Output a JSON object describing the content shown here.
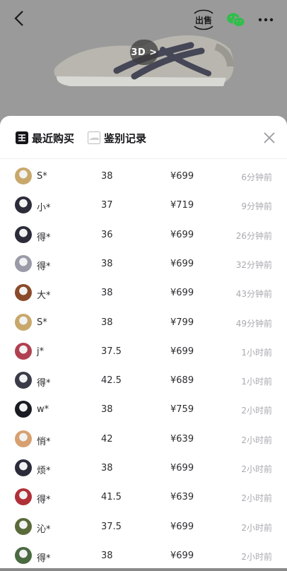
{
  "header": {
    "back_icon": "chevron-left-icon",
    "sell_label": "出售",
    "wechat_icon": "wechat-icon",
    "more_icon": "more-icon",
    "badge_3d": "3D >"
  },
  "sheet": {
    "tabs": [
      {
        "label": "最近购买",
        "icon": "dewu-logo-icon",
        "active": true
      },
      {
        "label": "鉴别记录",
        "icon": "shoe-thumbnail-icon",
        "active": false
      }
    ],
    "close_icon": "close-icon"
  },
  "records": [
    {
      "name": "S*",
      "size": "38",
      "price": "¥699",
      "time": "6分钟前",
      "avatar_color": "#c8a86a"
    },
    {
      "name": "小*",
      "size": "37",
      "price": "¥719",
      "time": "9分钟前",
      "avatar_color": "#2b2b3a"
    },
    {
      "name": "得*",
      "size": "36",
      "price": "¥699",
      "time": "26分钟前",
      "avatar_color": "#2b2b3a"
    },
    {
      "name": "得*",
      "size": "38",
      "price": "¥699",
      "time": "32分钟前",
      "avatar_color": "#9a9aa8"
    },
    {
      "name": "大*",
      "size": "38",
      "price": "¥699",
      "time": "43分钟前",
      "avatar_color": "#8a4a2a"
    },
    {
      "name": "S*",
      "size": "38",
      "price": "¥799",
      "time": "49分钟前",
      "avatar_color": "#c8a86a"
    },
    {
      "name": "j*",
      "size": "37.5",
      "price": "¥699",
      "time": "1小时前",
      "avatar_color": "#b04050"
    },
    {
      "name": "得*",
      "size": "42.5",
      "price": "¥689",
      "time": "1小时前",
      "avatar_color": "#3a3a48"
    },
    {
      "name": "w*",
      "size": "38",
      "price": "¥759",
      "time": "2小时前",
      "avatar_color": "#1a1a22"
    },
    {
      "name": "悄*",
      "size": "42",
      "price": "¥639",
      "time": "2小时前",
      "avatar_color": "#d8a070"
    },
    {
      "name": "烦*",
      "size": "38",
      "price": "¥699",
      "time": "2小时前",
      "avatar_color": "#2b2b3a"
    },
    {
      "name": "得*",
      "size": "41.5",
      "price": "¥639",
      "time": "2小时前",
      "avatar_color": "#b03038"
    },
    {
      "name": "沁*",
      "size": "37.5",
      "price": "¥699",
      "time": "2小时前",
      "avatar_color": "#5a6a3a"
    },
    {
      "name": "得*",
      "size": "38",
      "price": "¥699",
      "time": "2小时前",
      "avatar_color": "#4a6a40"
    }
  ]
}
